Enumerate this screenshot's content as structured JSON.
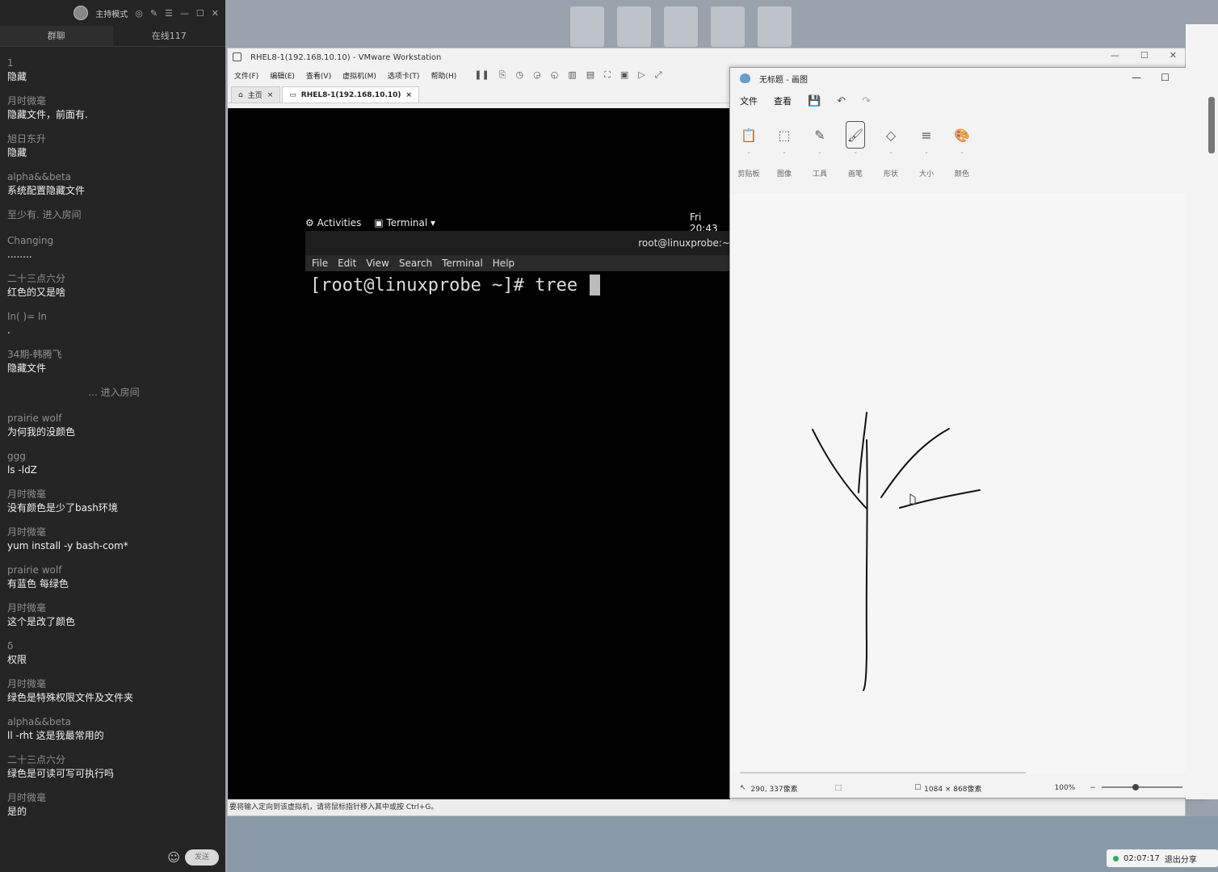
{
  "chat": {
    "header": {
      "host_mode": "主持模式"
    },
    "tabs": [
      "群聊",
      "在线117"
    ],
    "messages": [
      {
        "type": "msg",
        "name": "1",
        "text": "隐藏"
      },
      {
        "type": "msg",
        "name": "月时微毫",
        "text": "隐藏文件，前面有."
      },
      {
        "type": "msg",
        "name": "旭日东升",
        "text": "隐藏"
      },
      {
        "type": "msg",
        "name": "alpha&&beta",
        "text": "系统配置隐藏文件"
      },
      {
        "type": "sys_left",
        "text": "至少有. 进入房间"
      },
      {
        "type": "msg",
        "name": "Changing",
        "text": "........"
      },
      {
        "type": "msg",
        "name": "二十三点六分",
        "text": "红色的又是啥"
      },
      {
        "type": "msg",
        "name": "ln(    )=     ln",
        "text": "."
      },
      {
        "type": "msg",
        "name": "34期-韩腾飞",
        "text": "隐藏文件"
      },
      {
        "type": "sys",
        "text": "... 进入房间"
      },
      {
        "type": "msg",
        "name": "prairie wolf",
        "text": "为何我的没颜色"
      },
      {
        "type": "msg",
        "name": "ggg",
        "text": "ls -ldZ"
      },
      {
        "type": "msg",
        "name": "月时微毫",
        "text": "没有颜色是少了bash环境"
      },
      {
        "type": "msg",
        "name": "月时微毫",
        "text": "yum install -y bash-com*"
      },
      {
        "type": "msg",
        "name": "prairie wolf",
        "text": "有蓝色 每绿色"
      },
      {
        "type": "msg",
        "name": "月时微毫",
        "text": "这个是改了颜色"
      },
      {
        "type": "msg",
        "name": "δ",
        "text": "权限"
      },
      {
        "type": "msg",
        "name": "月时微毫",
        "text": "绿色是特殊权限文件及文件夹"
      },
      {
        "type": "msg",
        "name": "alpha&&beta",
        "text": "ll -rht  这是我最常用的"
      },
      {
        "type": "msg",
        "name": "二十三点六分",
        "text": "绿色是可读可写可执行吗"
      },
      {
        "type": "msg",
        "name": "月时微毫",
        "text": "是的"
      }
    ],
    "send_label": "发送"
  },
  "vmware": {
    "title": "RHEL8-1(192.168.10.10) - VMware Workstation",
    "menu": [
      "文件(F)",
      "编辑(E)",
      "查看(V)",
      "虚拟机(M)",
      "选项卡(T)",
      "帮助(H)"
    ],
    "tabs": [
      {
        "label": "主页"
      },
      {
        "label": "RHEL8-1(192.168.10.10)"
      }
    ],
    "status": "要将输入定向到该虚拟机，请将鼠标指针移入其中或按 Ctrl+G。",
    "gnome": {
      "activities": "Activities",
      "app": "Terminal",
      "clock": "Fri 20:43",
      "term_title": "root@linuxprobe:~",
      "term_menu": [
        "File",
        "Edit",
        "View",
        "Search",
        "Terminal",
        "Help"
      ],
      "prompt": "[root@linuxprobe ~]# tree "
    }
  },
  "paint": {
    "title": "无标题 - 画图",
    "menu": [
      "文件",
      "查看"
    ],
    "tools": [
      {
        "label": "剪贴板",
        "icon": "clipboard-icon",
        "glyph": "📋"
      },
      {
        "label": "图像",
        "icon": "select-icon",
        "glyph": "⬚"
      },
      {
        "label": "工具",
        "icon": "tools-icon",
        "glyph": "✎"
      },
      {
        "label": "画笔",
        "icon": "brush-icon",
        "glyph": "🖌"
      },
      {
        "label": "形状",
        "icon": "shapes-icon",
        "glyph": "◇"
      },
      {
        "label": "大小",
        "icon": "size-icon",
        "glyph": "≡"
      },
      {
        "label": "颜色",
        "icon": "palette-icon",
        "glyph": "🎨"
      }
    ],
    "status": {
      "cursor_pos": "290, 337像素",
      "canvas_size": "1084 × 868像素",
      "zoom": "100%"
    }
  },
  "live": {
    "time": "02:07:17",
    "exit": "退出分享"
  }
}
